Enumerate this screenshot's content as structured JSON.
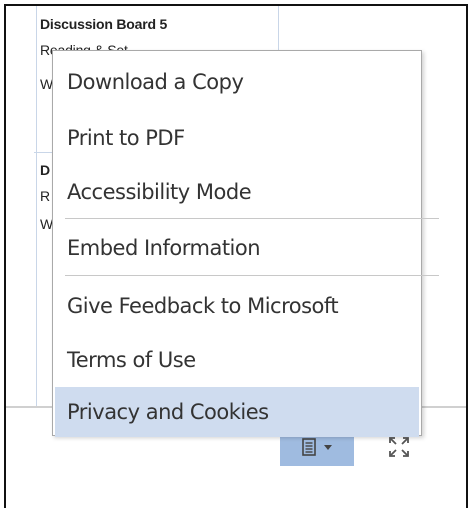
{
  "document": {
    "cell_1_title": "Discussion Board 5",
    "cell_1_line2": "Reading & Set",
    "cell_1_line3": "W",
    "cell_2_line1": "D",
    "cell_2_line2": "R",
    "cell_2_line3": "W"
  },
  "menu": {
    "items": [
      {
        "label": "Download a Copy"
      },
      {
        "label": "Print to PDF"
      },
      {
        "label": "Accessibility Mode"
      },
      {
        "label": "Embed Information"
      },
      {
        "label": "Give Feedback to Microsoft"
      },
      {
        "label": "Terms of Use"
      },
      {
        "label": "Privacy and Cookies"
      }
    ],
    "highlighted_index": 6
  },
  "toolbar": {
    "view_button_icon": "document-page-icon",
    "view_button_dropdown_icon": "caret-down-icon",
    "fullscreen_icon": "fullscreen-icon",
    "active_color": "#9fbbe0"
  },
  "colors": {
    "highlight": "#cfdcef",
    "menu_border": "#a9a9a9"
  }
}
